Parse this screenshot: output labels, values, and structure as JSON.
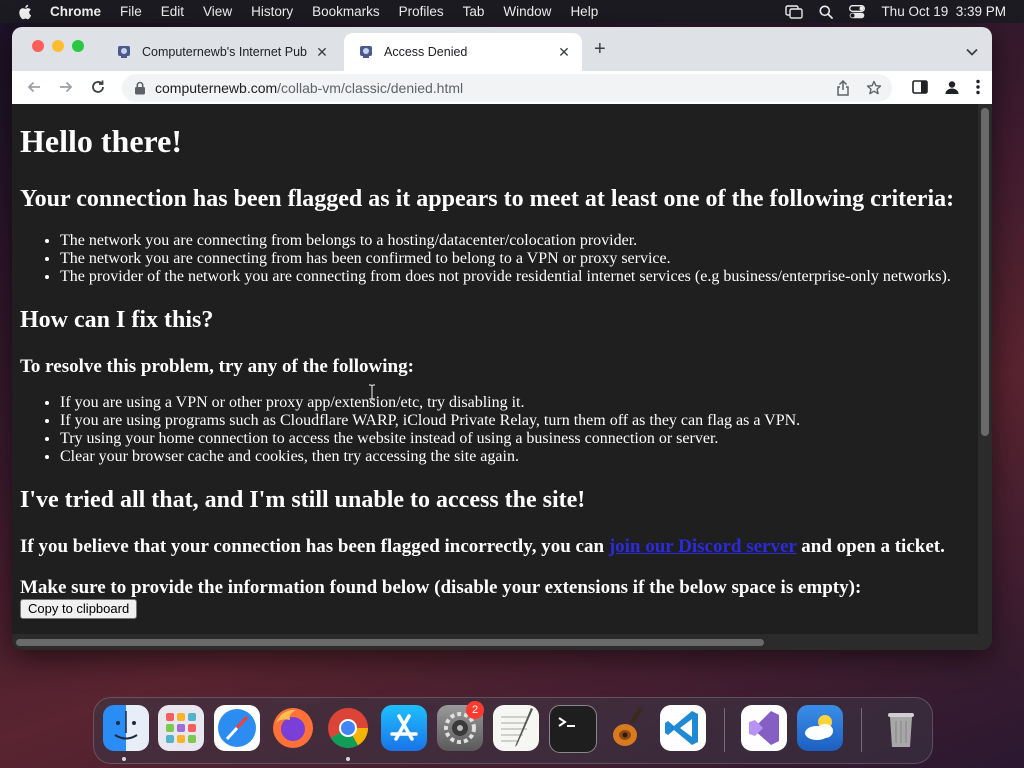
{
  "menubar": {
    "app_name": "Chrome",
    "menus": [
      "File",
      "Edit",
      "View",
      "History",
      "Bookmarks",
      "Profiles",
      "Tab",
      "Window",
      "Help"
    ],
    "clock": "Thu Oct 19  3:39 PM"
  },
  "tabs": [
    {
      "title": "Computernewb's Internet Pub",
      "active": false
    },
    {
      "title": "Access Denied",
      "active": true
    }
  ],
  "address_bar": {
    "domain": "computernewb.com",
    "path": "/collab-vm/classic/denied.html"
  },
  "page": {
    "heading": "Hello there!",
    "criteria_heading": "Your connection has been flagged as it appears to meet at least one of the following criteria:",
    "criteria": [
      "The network you are connecting from belongs to a hosting/datacenter/colocation provider.",
      "The network you are connecting from has been confirmed to belong to a VPN or proxy service.",
      "The provider of the network you are connecting from does not provide residential internet services (e.g business/enterprise-only networks)."
    ],
    "fix_heading": "How can I fix this?",
    "resolve_heading": "To resolve this problem, try any of the following:",
    "fixes": [
      "If you are using a VPN or other proxy app/extension/etc, try disabling it.",
      "If you are using programs such as Cloudflare WARP, iCloud Private Relay, turn them off as they can flag as a VPN.",
      "Try using your home connection to access the website instead of using a business connection or server.",
      "Clear your browser cache and cookies, then try accessing the site again."
    ],
    "tried_heading": "I've tried all that, and I'm still unable to access the site!",
    "incorrect_prefix": "If you believe that your connection has been flagged incorrectly, you can ",
    "discord_link": "join our Discord server",
    "incorrect_suffix": " and open a ticket.",
    "provide_info": "Make sure to provide the information found below (disable your extensions if the below space is empty):",
    "copy_button": "Copy to clipboard"
  },
  "dock": {
    "apps": [
      "finder-icon",
      "launchpad-icon",
      "safari-icon",
      "firefox-icon",
      "chrome-icon",
      "app-store-icon",
      "system-settings-icon",
      "textedit-icon",
      "terminal-icon",
      "garageband-icon",
      "vscode-icon",
      "visual-studio-icon",
      "weather-icon",
      "trash-icon"
    ],
    "settings_badge": "2"
  },
  "colors": {
    "page_bg": "#1f1f1f",
    "link": "#2b2bdb",
    "tabstrip": "#dee1e6"
  }
}
